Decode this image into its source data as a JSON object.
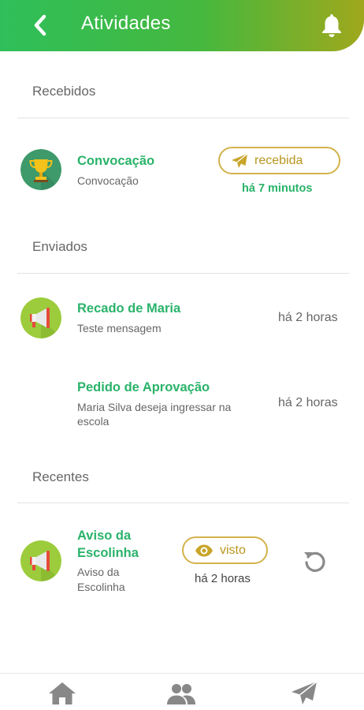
{
  "header": {
    "title": "Atividades",
    "back_icon": "chevron-left-icon",
    "bell_icon": "bell-icon",
    "gradient": [
      "#2fbf5a",
      "#9fa81c"
    ]
  },
  "sections": {
    "received": "Recebidos",
    "sent": "Enviados",
    "recent": "Recentes"
  },
  "received": {
    "title": "Convocação",
    "subtitle": "Convocação",
    "status": "recebida",
    "status_icon": "paper-plane-icon",
    "time": "há 7 minutos"
  },
  "sent": [
    {
      "title": "Recado de Maria",
      "subtitle": "Teste mensagem",
      "time": "há 2 horas",
      "icon": "megaphone-icon"
    },
    {
      "title": "Pedido de Aprovação",
      "subtitle_line1": "Maria Silva deseja ingressar na",
      "subtitle_line2": "escola",
      "time": "há 2 horas"
    }
  ],
  "recent": {
    "title_line1": "Aviso da",
    "title_line2": "Escolinha",
    "subtitle_line1": "Aviso da",
    "subtitle_line2": "Escolinha",
    "status": "visto",
    "status_icon": "eye-icon",
    "time": "há 2 horas",
    "action_icon": "refresh-icon"
  },
  "bottom_nav": [
    "home-icon",
    "people-icon",
    "paper-plane-icon"
  ],
  "colors": {
    "accent_green": "#2ab36a",
    "gold": "#d2b24a",
    "gold_text": "#b9961e"
  }
}
